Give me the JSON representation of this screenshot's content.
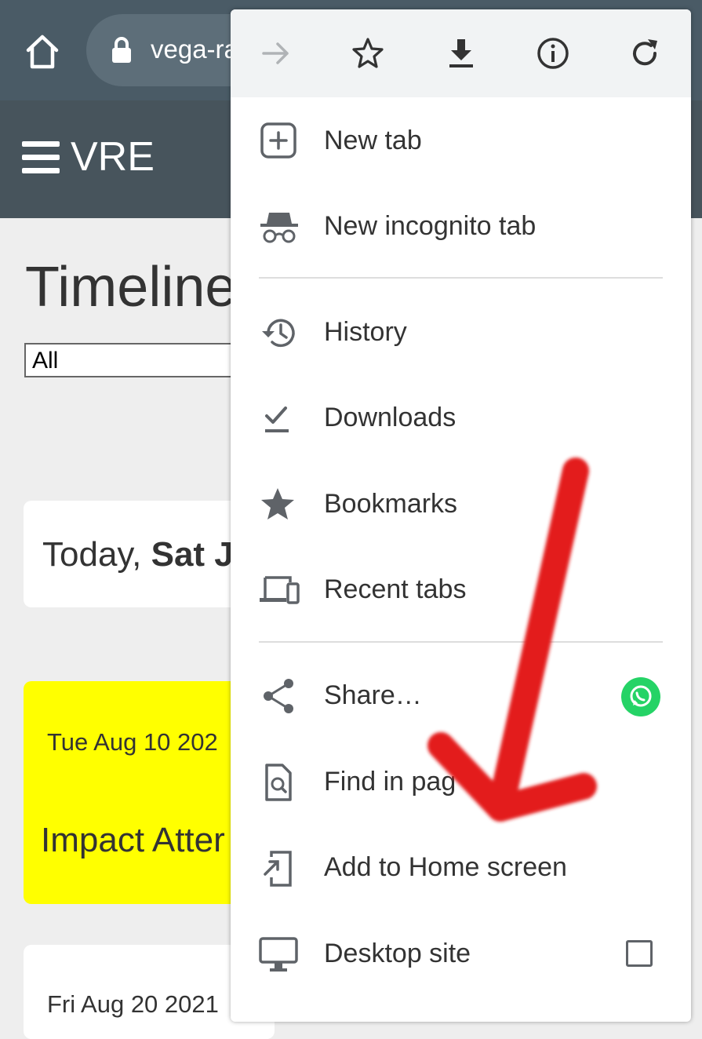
{
  "browser": {
    "url_text": "vega-ra",
    "icons": {
      "home": "home-icon",
      "lock": "lock-icon"
    }
  },
  "site": {
    "brand": "VRE",
    "menu_icon": "hamburger-icon"
  },
  "page": {
    "title": "Timeline",
    "filter_value": "All",
    "today_prefix": "Today, ",
    "today_bold": "Sat J",
    "events": [
      {
        "date": "Tue Aug 10 202",
        "title": "Impact Atter",
        "color": "#ffff00"
      },
      {
        "date": "Fri Aug 20 2021"
      }
    ]
  },
  "menu": {
    "toolbar_icons": [
      "forward-icon",
      "bookmark-star-icon",
      "download-icon",
      "info-icon",
      "reload-icon"
    ],
    "items": [
      {
        "label": "New tab",
        "icon": "new-tab-icon"
      },
      {
        "label": "New incognito tab",
        "icon": "incognito-icon"
      },
      {
        "label": "History",
        "icon": "history-icon"
      },
      {
        "label": "Downloads",
        "icon": "downloads-icon"
      },
      {
        "label": "Bookmarks",
        "icon": "bookmarks-icon"
      },
      {
        "label": "Recent tabs",
        "icon": "recent-tabs-icon"
      },
      {
        "label": "Share…",
        "icon": "share-icon",
        "badge": "whatsapp-icon"
      },
      {
        "label": "Find in pag",
        "icon": "find-in-page-icon"
      },
      {
        "label": "Add to Home screen",
        "icon": "add-to-home-icon"
      },
      {
        "label": "Desktop site",
        "icon": "desktop-icon",
        "checkbox": false
      }
    ]
  },
  "annotation": {
    "type": "arrow",
    "color": "#e31b1b",
    "points_to": "Add to Home screen"
  },
  "colors": {
    "topbar": "#4a5b66",
    "site_header": "#47545c",
    "menu_toolbar": "#f1f3f4",
    "icon": "#5f6368",
    "whatsapp": "#25d366"
  }
}
